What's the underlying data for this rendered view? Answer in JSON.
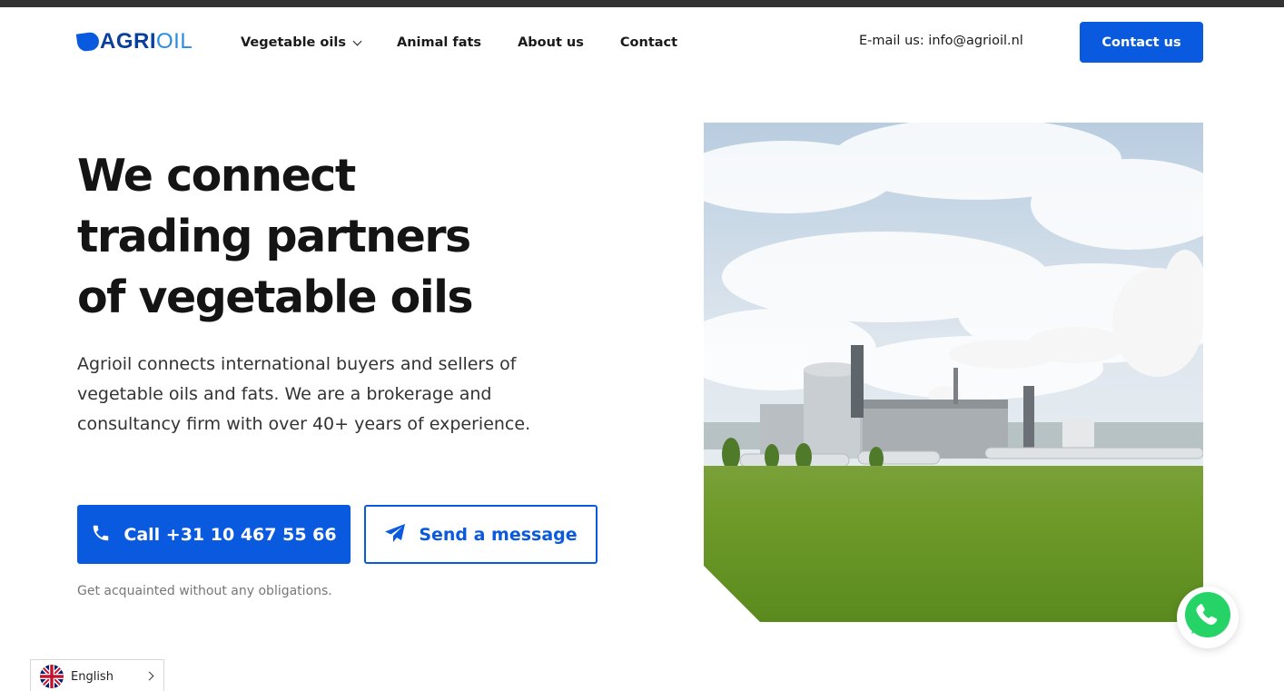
{
  "header": {
    "logo": {
      "part1": "AGRI",
      "part2": "OIL"
    },
    "nav": [
      {
        "label": "Vegetable oils",
        "has_dropdown": true
      },
      {
        "label": "Animal fats"
      },
      {
        "label": "About us"
      },
      {
        "label": "Contact"
      }
    ],
    "email_text": "E-mail us: info@agrioil.nl",
    "cta_label": "Contact us"
  },
  "hero": {
    "title_lines": [
      "We connect",
      "trading partners",
      "of vegetable oils"
    ],
    "description": "Agrioil connects international buyers and sellers of vegetable oils and fats. We are a brokerage and consultancy firm with over 40+ years of experience.",
    "call_button": {
      "label": "Call +31 10 467 55 66",
      "icon": "phone-icon"
    },
    "message_button": {
      "label": "Send a message",
      "icon": "paper-plane-icon"
    },
    "note": "Get acquainted without any obligations."
  },
  "language_selector": {
    "label": "English",
    "icon": "uk-flag-icon"
  },
  "whatsapp": {
    "icon": "whatsapp-icon"
  },
  "colors": {
    "primary": "#0a5ae0",
    "topbar": "#333333",
    "text": "#141414",
    "muted": "#777777"
  }
}
